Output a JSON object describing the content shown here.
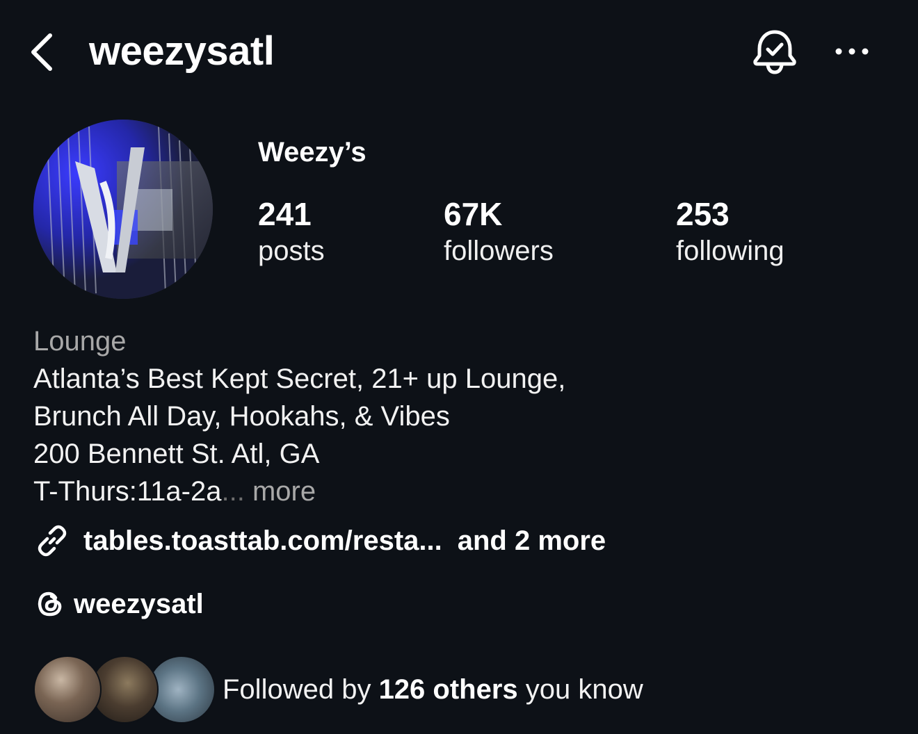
{
  "header": {
    "username": "weezysatl",
    "back_icon": "chevron-left-icon",
    "bell_icon": "notification-bell-check-icon",
    "more_icon": "more-horizontal-icon"
  },
  "profile": {
    "display_name": "Weezy’s",
    "avatar_icon": "profile-avatar-photo",
    "stats": {
      "posts": {
        "value": "241",
        "label": "posts"
      },
      "followers": {
        "value": "67K",
        "label": "followers"
      },
      "following": {
        "value": "253",
        "label": "following"
      }
    }
  },
  "bio": {
    "category": "Lounge",
    "lines": [
      "Atlanta’s Best Kept Secret, 21+ up Lounge,",
      "Brunch All Day, Hookahs, & Vibes",
      "200 Bennett St. Atl, GA",
      "T-Thurs:11a-2a"
    ],
    "ellipsis": "...",
    "more_label": "more"
  },
  "links": {
    "icon": "link-icon",
    "primary": "tables.toasttab.com/resta...",
    "more": "and 2 more"
  },
  "threads": {
    "icon": "threads-icon",
    "handle": "weezysatl"
  },
  "followed_by": {
    "prefix": "Followed by",
    "highlight": "126 others",
    "suffix": "you know"
  },
  "colors": {
    "background": "#0d1117",
    "text_primary": "#ffffff",
    "text_secondary": "#a8a8a8"
  }
}
